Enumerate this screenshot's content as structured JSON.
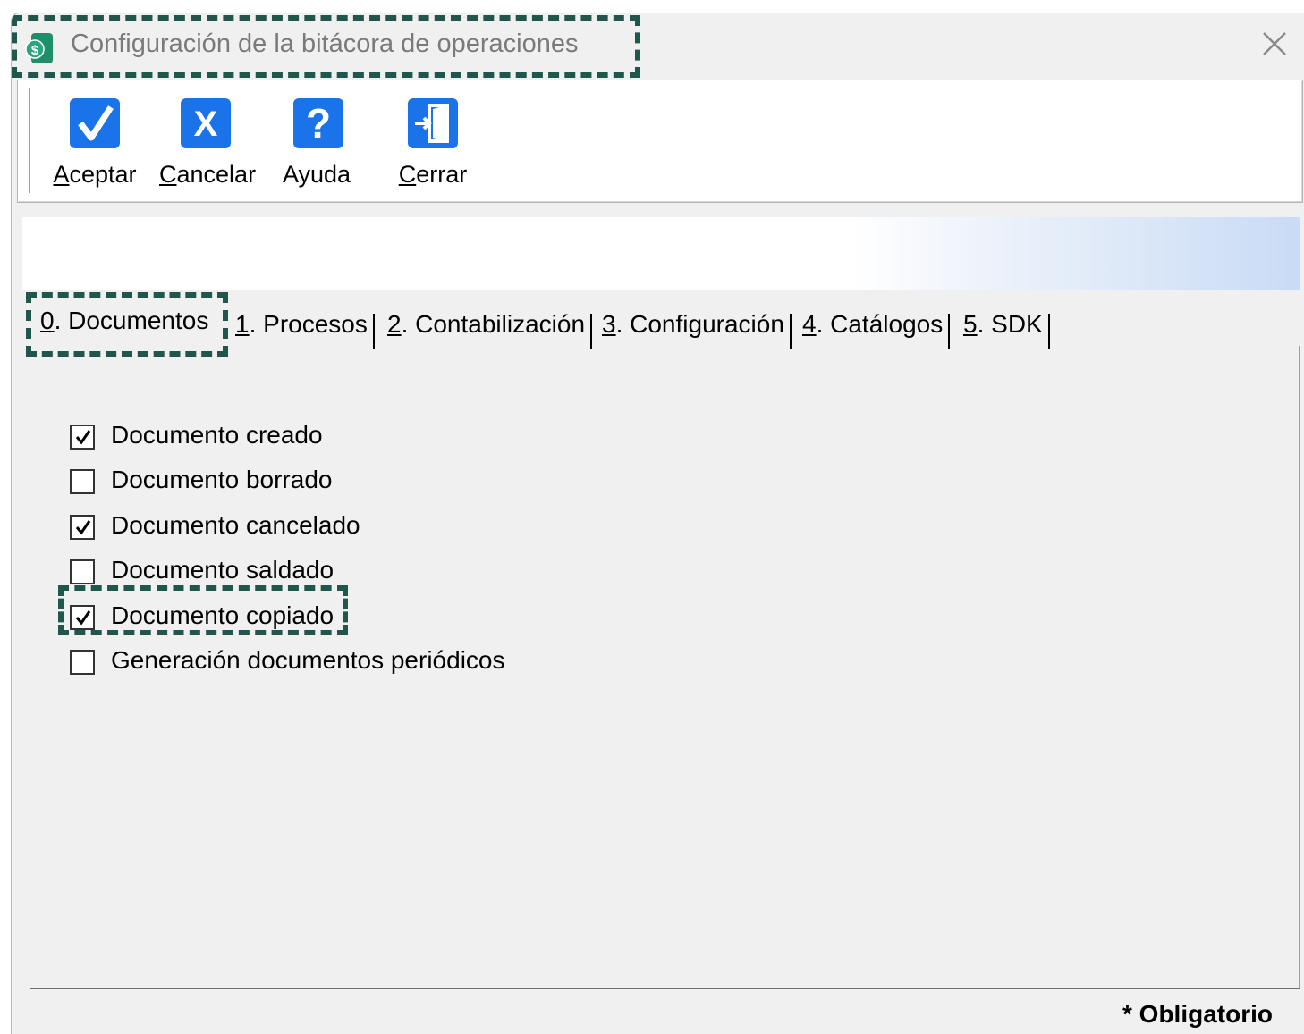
{
  "window": {
    "title": "Configuración de la bitácora de operaciones",
    "close_glyph": "✕"
  },
  "toolbar": {
    "buttons": [
      {
        "label": "Aceptar",
        "mnemonic": "A",
        "rest": "ceptar",
        "icon": "check-icon",
        "color": "#1a73e8"
      },
      {
        "label": "Cancelar",
        "mnemonic": "C",
        "rest": "ancelar",
        "icon": "x-icon",
        "color": "#1a73e8"
      },
      {
        "label": "Ayuda",
        "mnemonic": "",
        "rest": "Ayuda",
        "icon": "help-icon",
        "color": "#1a73e8"
      },
      {
        "label": "Cerrar",
        "mnemonic": "C",
        "rest": "errar",
        "icon": "exit-door-icon",
        "color": "#1a73e8"
      }
    ]
  },
  "tabs": [
    {
      "label": "0. Documentos",
      "num": "0",
      "rest": ". Documentos",
      "active": true
    },
    {
      "label": "1. Procesos",
      "num": "1",
      "rest": ". Procesos",
      "active": false
    },
    {
      "label": "2. Contabilización",
      "num": "2",
      "rest": ". Contabilización",
      "active": false
    },
    {
      "label": "3. Configuración",
      "num": "3",
      "rest": ". Configuración",
      "active": false
    },
    {
      "label": "4. Catálogos",
      "num": "4",
      "rest": ". Catálogos",
      "active": false
    },
    {
      "label": "5. SDK",
      "num": "5",
      "rest": ". SDK",
      "active": false
    }
  ],
  "checkboxes": [
    {
      "label": "Documento creado",
      "checked": true
    },
    {
      "label": "Documento borrado",
      "checked": false
    },
    {
      "label": "Documento cancelado",
      "checked": true
    },
    {
      "label": "Documento saldado",
      "checked": false
    },
    {
      "label": "Documento copiado",
      "checked": true
    },
    {
      "label": "Generación documentos periódicos",
      "checked": false
    }
  ],
  "footer": {
    "required_note": "* Obligatorio"
  },
  "colors": {
    "highlight": "#21564c",
    "icon_blue": "#1a73e8"
  }
}
